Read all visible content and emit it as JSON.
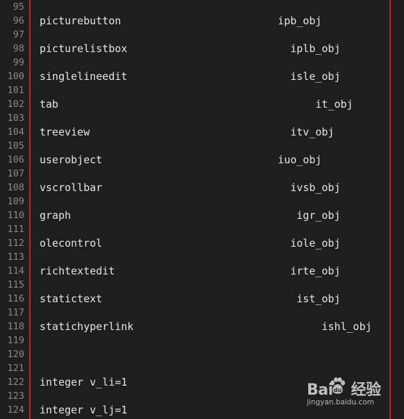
{
  "accent_border_color": "#c81e1e",
  "background_color": "#1e1e1e",
  "lines": [
    {
      "number": "95",
      "code": ""
    },
    {
      "number": "96",
      "code": "picturebutton                         ipb_obj"
    },
    {
      "number": "97",
      "code": ""
    },
    {
      "number": "98",
      "code": "picturelistbox                          iplb_obj"
    },
    {
      "number": "99",
      "code": ""
    },
    {
      "number": "100",
      "code": "singlelineedit                          isle_obj"
    },
    {
      "number": "101",
      "code": ""
    },
    {
      "number": "102",
      "code": "tab                                         it_obj"
    },
    {
      "number": "103",
      "code": ""
    },
    {
      "number": "104",
      "code": "treeview                                itv_obj"
    },
    {
      "number": "105",
      "code": ""
    },
    {
      "number": "106",
      "code": "userobject                            iuo_obj"
    },
    {
      "number": "107",
      "code": ""
    },
    {
      "number": "108",
      "code": "vscrollbar                              ivsb_obj"
    },
    {
      "number": "109",
      "code": ""
    },
    {
      "number": "110",
      "code": "graph                                    igr_obj"
    },
    {
      "number": "111",
      "code": ""
    },
    {
      "number": "112",
      "code": "olecontrol                              iole_obj"
    },
    {
      "number": "113",
      "code": ""
    },
    {
      "number": "114",
      "code": "richtextedit                            irte_obj"
    },
    {
      "number": "115",
      "code": ""
    },
    {
      "number": "116",
      "code": "statictext                               ist_obj"
    },
    {
      "number": "117",
      "code": ""
    },
    {
      "number": "118",
      "code": "statichyperlink                              ishl_obj"
    },
    {
      "number": "119",
      "code": ""
    },
    {
      "number": "120",
      "code": ""
    },
    {
      "number": "121",
      "code": ""
    },
    {
      "number": "122",
      "code": "integer v_li=1"
    },
    {
      "number": "123",
      "code": ""
    },
    {
      "number": "124",
      "code": "integer v_lj=1"
    }
  ],
  "watermark": {
    "brand_prefix": "Bai",
    "brand_suffix": "经验",
    "url": "jingyan.baidu.com"
  }
}
